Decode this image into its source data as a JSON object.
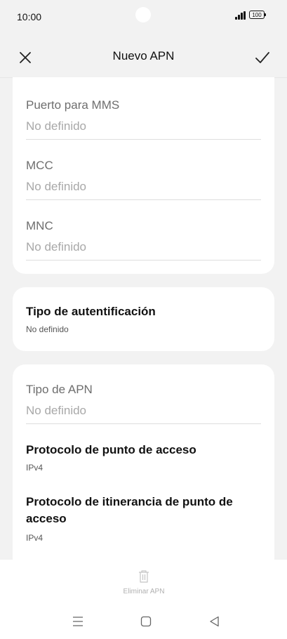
{
  "status": {
    "time": "10:00",
    "battery": "100"
  },
  "header": {
    "title": "Nuevo APN"
  },
  "card1": {
    "fields": [
      {
        "label": "Puerto para MMS",
        "value": "No definido"
      },
      {
        "label": "MCC",
        "value": "No definido"
      },
      {
        "label": "MNC",
        "value": "No definido"
      }
    ]
  },
  "card2": {
    "title": "Tipo de autentificación",
    "sub": "No definido"
  },
  "card3": {
    "apn_type": {
      "label": "Tipo de APN",
      "value": "No definido"
    },
    "protocol": {
      "title": "Protocolo de punto de acceso",
      "sub": "IPv4"
    },
    "roaming": {
      "title": "Protocolo de itinerancia de punto de acceso",
      "sub": "IPv4"
    }
  },
  "footer": {
    "delete_label": "Eliminar APN"
  }
}
